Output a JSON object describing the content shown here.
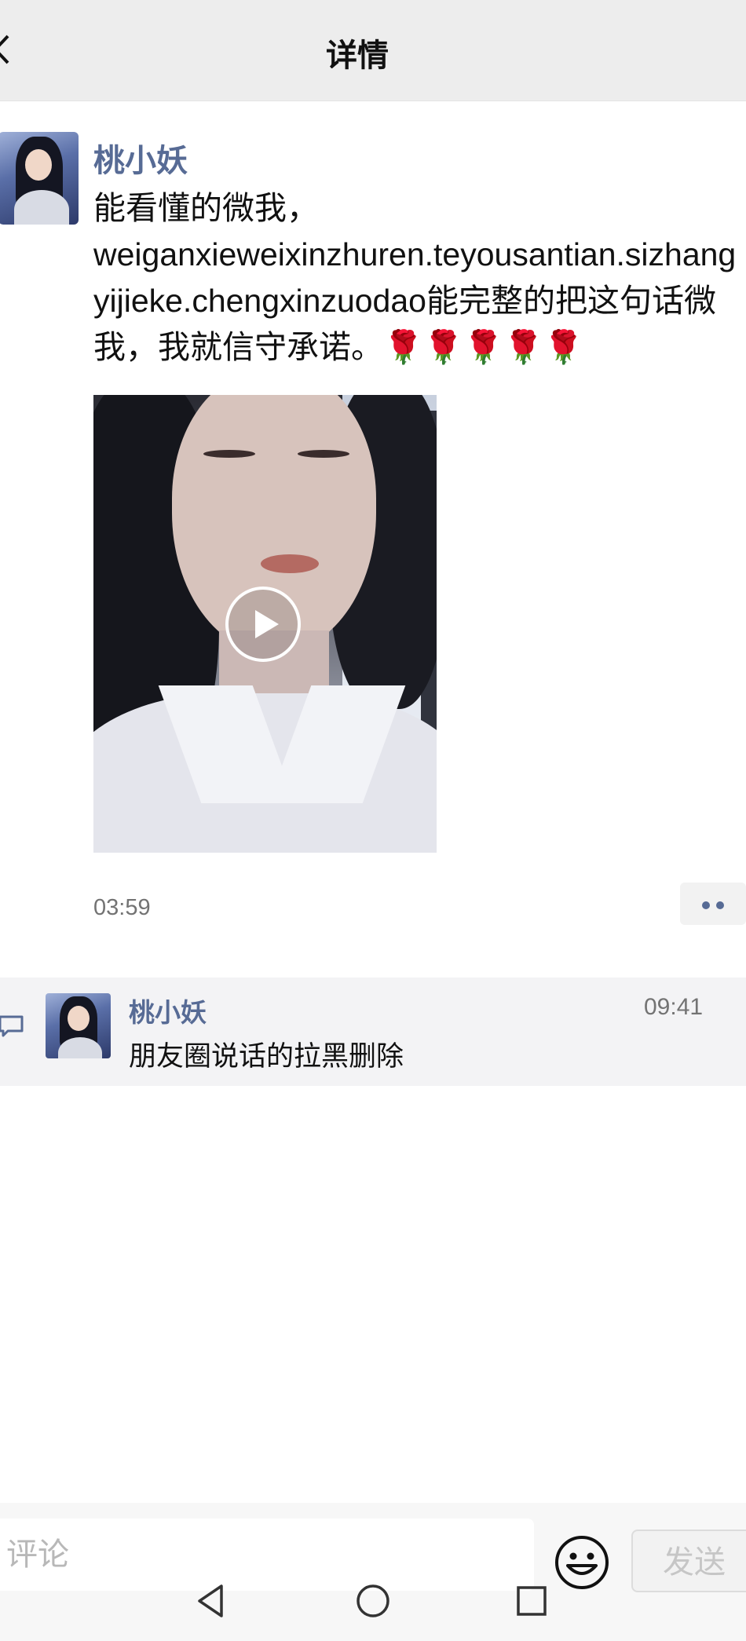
{
  "header": {
    "title": "详情",
    "back_icon": "chevron-left-icon"
  },
  "post": {
    "author": "桃小妖",
    "text": "能看懂的微我，\nweiganxieweixinzhuren.teyousantian.sizhangyijieke.chengxinzuodao能完整的把这句话微我，我就信守承诺。",
    "emojis": "🌹🌹🌹🌹🌹",
    "video_icon": "play-icon",
    "time": "03:59",
    "more_icon": "more-dots-icon"
  },
  "comments": [
    {
      "author": "桃小妖",
      "time": "09:41",
      "text": "朋友圈说话的拉黑删除"
    }
  ],
  "composer": {
    "placeholder": "评论",
    "emoji_icon": "emoji-icon",
    "send_label": "发送"
  },
  "system_nav": {
    "icons": [
      "triangle-back-icon",
      "circle-home-icon",
      "square-recent-icon"
    ]
  },
  "colors": {
    "name_link": "#576b95",
    "header_bg": "#ededed",
    "comment_bg": "#f3f3f5"
  }
}
